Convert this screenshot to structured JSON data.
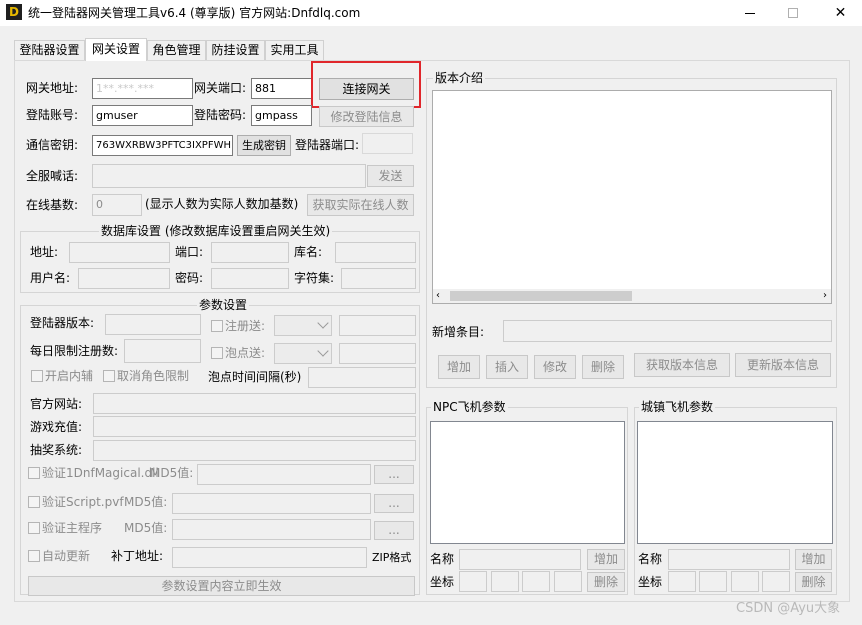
{
  "window": {
    "title": "统一登陆器网关管理工具v6.4 (尊享版)   官方网站:Dnfdlq.com",
    "logo_letter": "D"
  },
  "tabs": [
    "登陆器设置",
    "网关设置",
    "角色管理",
    "防挂设置",
    "实用工具"
  ],
  "gateway": {
    "addr_label": "网关地址:",
    "addr_value": "1**.***.***",
    "port_label": "网关端口:",
    "port_value": "881",
    "connect_button": "连接网关",
    "account_label": "登陆账号:",
    "account_value": "gmuser",
    "password_label": "登陆密码:",
    "password_value": "gmpass",
    "modify_button": "修改登陆信息",
    "key_label": "通信密钥:",
    "key_value": "763WXRBW3PFTC3IXPFWH",
    "gen_key_button": "生成密钥",
    "launcher_port_label": "登陆器端口:",
    "shout_label": "全服喊话:",
    "send_button": "发送",
    "online_label": "在线基数:",
    "online_value": "0",
    "online_note": "(显示人数为实际人数加基数)",
    "get_online_button": "获取实际在线人数"
  },
  "db": {
    "group_label": "数据库设置 (修改数据库设置重启网关生效)",
    "addr_label": "地址:",
    "port_label": "端口:",
    "dbname_label": "库名:",
    "user_label": "用户名:",
    "pwd_label": "密码:",
    "charset_label": "字符集:"
  },
  "params": {
    "group_label": "参数设置",
    "version_label": "登陆器版本:",
    "register_send": "注册送:",
    "daily_limit_label": "每日限制注册数:",
    "bubble_send": "泡点送:",
    "enable_helper": "开启内辅",
    "cancel_role_limit": "取消角色限制",
    "bubble_interval_label": "泡点时间间隔(秒)",
    "official_site_label": "官方网站:",
    "recharge_label": "游戏充值:",
    "lottery_label": "抽奖系统:",
    "verify_dll": "验证1DnfMagical.dll",
    "verify_script": "验证Script.pvf",
    "verify_main": "验证主程序",
    "md5_label": "MD5值:",
    "auto_update": "自动更新",
    "patch_label": "补丁地址:",
    "zip_label": "ZIP格式",
    "browse": "...",
    "apply_button": "参数设置内容立即生效"
  },
  "version": {
    "group_label": "版本介绍",
    "new_item_label": "新增条目:",
    "buttons": [
      "增加",
      "插入",
      "修改",
      "删除",
      "获取版本信息",
      "更新版本信息"
    ]
  },
  "npc": {
    "group_label": "NPC飞机参数",
    "name_label": "名称",
    "coord_label": "坐标",
    "add": "增加",
    "del": "删除"
  },
  "city": {
    "group_label": "城镇飞机参数",
    "name_label": "名称",
    "coord_label": "坐标",
    "add": "增加",
    "del": "删除"
  },
  "watermark": "CSDN @Ayu大象",
  "colors": {
    "highlight": "#e0262b",
    "logo_bg": "#1f1f1f",
    "logo_fg": "#e6b800"
  }
}
